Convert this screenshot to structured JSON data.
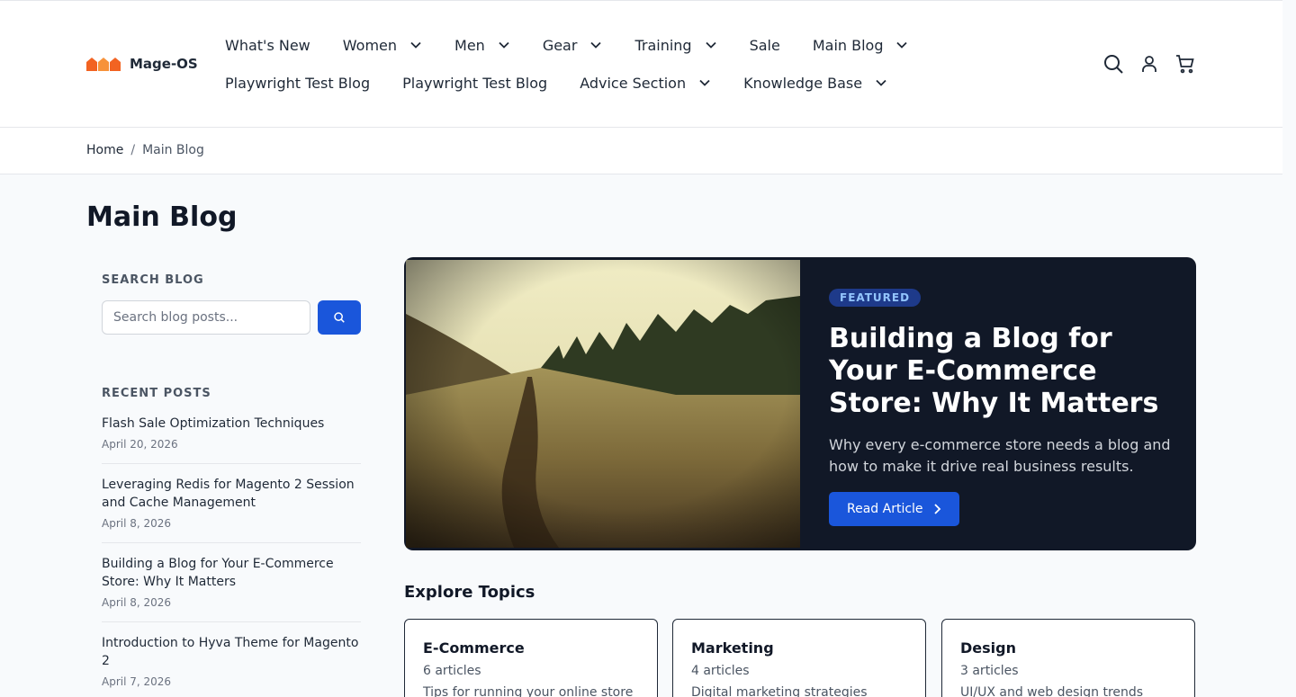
{
  "brand": {
    "name": "Mage-OS"
  },
  "nav": {
    "row1": [
      {
        "label": "What's New",
        "dropdown": false
      },
      {
        "label": "Women",
        "dropdown": true
      },
      {
        "label": "Men",
        "dropdown": true
      },
      {
        "label": "Gear",
        "dropdown": true
      },
      {
        "label": "Training",
        "dropdown": true
      },
      {
        "label": "Sale",
        "dropdown": false
      },
      {
        "label": "Main Blog",
        "dropdown": true
      }
    ],
    "row2": [
      {
        "label": "Playwright Test Blog",
        "dropdown": false
      },
      {
        "label": "Playwright Test Blog",
        "dropdown": false
      },
      {
        "label": "Advice Section",
        "dropdown": true
      },
      {
        "label": "Knowledge Base",
        "dropdown": true
      }
    ]
  },
  "header_icons": [
    "search-icon",
    "account-icon",
    "cart-icon"
  ],
  "breadcrumb": {
    "home": "Home",
    "separator": "/",
    "current": "Main Blog"
  },
  "page": {
    "title": "Main Blog"
  },
  "sidebar": {
    "search_heading": "SEARCH BLOG",
    "search_placeholder": "Search blog posts...",
    "recent_heading": "RECENT POSTS",
    "recent_posts": [
      {
        "title": "Flash Sale Optimization Techniques",
        "date": "April 20, 2026"
      },
      {
        "title": "Leveraging Redis for Magento 2 Session and Cache Management",
        "date": "April 8, 2026"
      },
      {
        "title": "Building a Blog for Your E-Commerce Store: Why It Matters",
        "date": "April 8, 2026"
      },
      {
        "title": "Introduction to Hyva Theme for Magento 2",
        "date": "April 7, 2026"
      }
    ]
  },
  "featured": {
    "badge": "FEATURED",
    "title": "Building a Blog for Your E-Commerce Store: Why It Matters",
    "description": "Why every e-commerce store needs a blog and how to make it drive real business results.",
    "button": "Read Article"
  },
  "explore": {
    "title": "Explore Topics",
    "topics": [
      {
        "name": "E-Commerce",
        "count": "6 articles",
        "desc": "Tips for running your online store"
      },
      {
        "name": "Marketing",
        "count": "4 articles",
        "desc": "Digital marketing strategies"
      },
      {
        "name": "Design",
        "count": "3 articles",
        "desc": "UI/UX and web design trends"
      }
    ]
  },
  "colors": {
    "primary": "#1a56db",
    "featured_bg": "#111827",
    "logo": "#f26322"
  }
}
